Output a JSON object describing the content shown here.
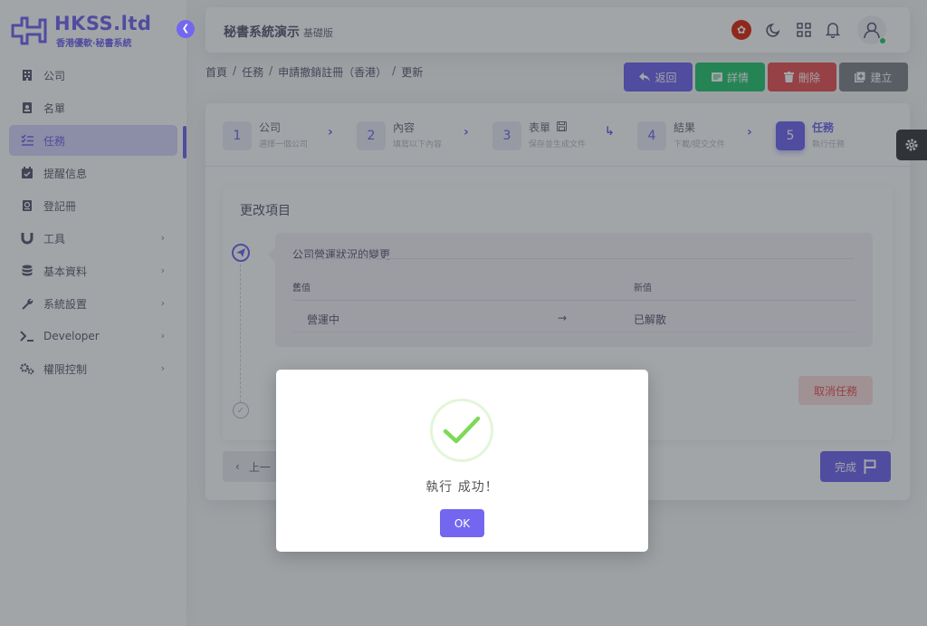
{
  "brand": {
    "name": "HKSS.ltd",
    "subtitle": "香港優軟‧秘書系統"
  },
  "sidebar": {
    "items": [
      {
        "label": "公司",
        "icon": "building-icon",
        "has_children": false,
        "active": false
      },
      {
        "label": "名單",
        "icon": "contact-card-icon",
        "has_children": false,
        "active": false
      },
      {
        "label": "任務",
        "icon": "task-list-icon",
        "has_children": false,
        "active": true
      },
      {
        "label": "提醒信息",
        "icon": "calendar-check-icon",
        "has_children": false,
        "active": false
      },
      {
        "label": "登記冊",
        "icon": "register-book-icon",
        "has_children": false,
        "active": false
      },
      {
        "label": "工具",
        "icon": "magnet-icon",
        "has_children": true,
        "active": false
      },
      {
        "label": "基本資料",
        "icon": "database-icon",
        "has_children": true,
        "active": false
      },
      {
        "label": "系統設置",
        "icon": "wrench-icon",
        "has_children": true,
        "active": false
      },
      {
        "label": "Developer",
        "icon": "terminal-icon",
        "has_children": true,
        "active": false
      },
      {
        "label": "權限控制",
        "icon": "cogs-icon",
        "has_children": true,
        "active": false
      }
    ]
  },
  "header": {
    "title": "秘書系統演示",
    "edition": "基礎版"
  },
  "breadcrumb": [
    "首頁",
    "任務",
    "申請撤銷註冊（香港）",
    "更新"
  ],
  "actions": {
    "back": "返回",
    "detail": "詳情",
    "delete": "刪除",
    "create": "建立"
  },
  "steps": [
    {
      "num": "1",
      "title": "公司",
      "sub": "選擇一個公司",
      "active": false
    },
    {
      "num": "2",
      "title": "內容",
      "sub": "填寫以下內容",
      "active": false
    },
    {
      "num": "3",
      "title": "表單",
      "sub": "保存並生成文件",
      "active": false
    },
    {
      "num": "4",
      "title": "結果",
      "sub": "下載/提交文件",
      "active": false
    },
    {
      "num": "5",
      "title": "任務",
      "sub": "執行任務",
      "active": true
    }
  ],
  "changes": {
    "section_title": "更改項目",
    "item_title": "公司營運狀況的變更",
    "col_old": "舊值",
    "col_new": "新值",
    "old_value": "營運中",
    "new_value": "已解散",
    "cancel_task": "取消任務"
  },
  "footer": {
    "prev": "上一",
    "finish": "完成"
  },
  "modal": {
    "message": "執行 成功！",
    "ok": "OK"
  },
  "colors": {
    "primary": "#7367f0",
    "success": "#28c76f",
    "danger": "#ea5455",
    "secondary": "#82868b"
  }
}
